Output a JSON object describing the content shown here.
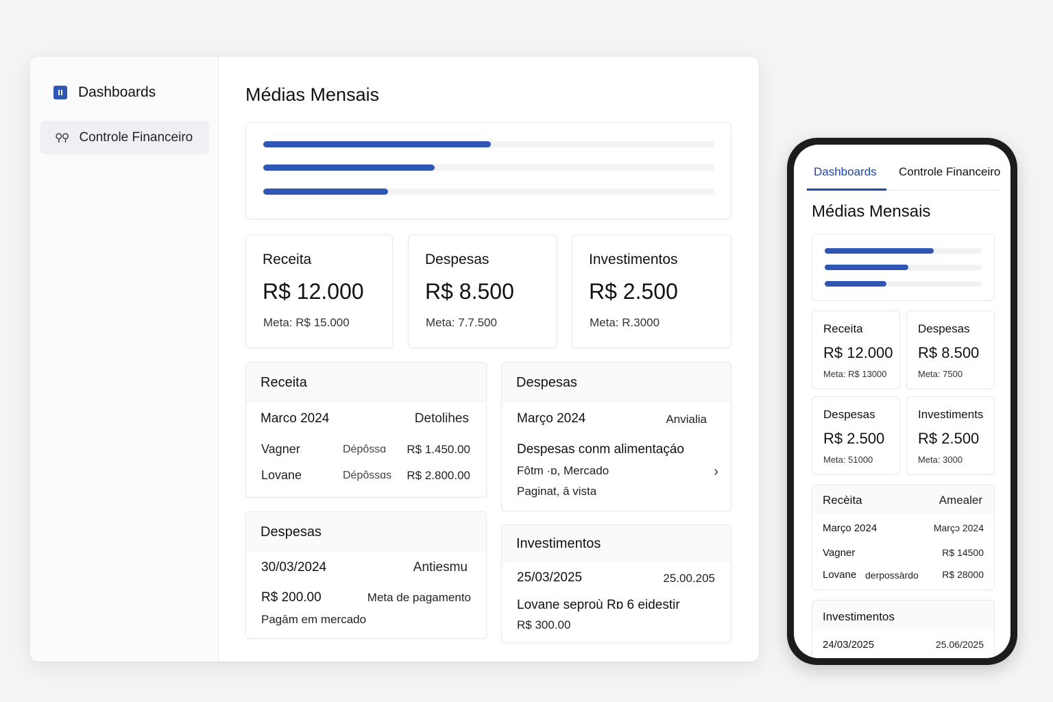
{
  "sidebar": {
    "title": "Dashboards",
    "items": [
      {
        "label": "Controle Financeiro"
      }
    ]
  },
  "main": {
    "title": "Médias Mensais",
    "progress": [
      0.505,
      0.38,
      0.277
    ],
    "stats": [
      {
        "label": "Receita",
        "value": "R$ 12.000",
        "meta": "Meta: R$ 15.000"
      },
      {
        "label": "Despesas",
        "value": "R$ 8.500",
        "meta": "Meta: 7.7.500"
      },
      {
        "label": "Investimentos",
        "value": "R$ 2.500",
        "meta": "Meta: R.3000"
      }
    ],
    "receita": {
      "title": "Receita",
      "period": "Marco 2024",
      "link": "Detolihes",
      "rows": [
        {
          "name": "Vagner",
          "type": "Dépôssɑ",
          "amount": "R$ 1.450.00"
        },
        {
          "name": "Lovane",
          "type": "Dépôssɑs",
          "amount": "R$ 2.800.00"
        }
      ]
    },
    "despesas_month": {
      "title": "Despesas",
      "period": "Março 2024",
      "link": "Anvialia",
      "item_title": "Despesas conm alimentaçáo",
      "line1": "Fôtm ·ɒ, Mercado",
      "line2": "Paginat, ā vista"
    },
    "despesas_date": {
      "title": "Despesas",
      "date": "30/03/2024",
      "link": "Antiesmu",
      "amount": "R$ 200.00",
      "status": "Meta de pagamento",
      "note": "Pagām em mercado"
    },
    "investimentos": {
      "title": "Investimentos",
      "date": "25/03/2025",
      "date2": "25.00.205",
      "desc": "Lovane seproù Rɒ 6  eidestir",
      "amount": "R$ 300.00"
    }
  },
  "mobile": {
    "tabs": [
      "Dashboards",
      "Controle Financeiro"
    ],
    "title": "Médias Mensais",
    "progress": [
      0.69,
      0.53,
      0.39
    ],
    "stats": [
      {
        "label": "Receita",
        "value": "R$ 12.000",
        "meta": "Meta: R$ 13000"
      },
      {
        "label": "Despesas",
        "value": "R$ 8.500",
        "meta": "Meta: 7500"
      },
      {
        "label": "Despesas",
        "value": "R$ 2.500",
        "meta": "Meta: 51000"
      },
      {
        "label": "Investiments",
        "value": "R$ 2.500",
        "meta": "Meta: 3000"
      }
    ],
    "receita": {
      "title": "Recèita",
      "link": "Amealer",
      "period": "Março 2024",
      "period2": "Marçɔ 2024",
      "rows": [
        {
          "name": "Vagner",
          "type": "",
          "amount": "R$ 14500"
        },
        {
          "name": "Lovane",
          "type": "derpossàrdo",
          "amount": "R$ 28000"
        }
      ]
    },
    "investimentos": {
      "title": "Investimentos",
      "date": "24/03/2025",
      "date2": "25.06/2025"
    }
  },
  "colors": {
    "accent": "#2f56b5",
    "tab_active": "#1f44a8"
  },
  "icons": [
    "dashboard-icon",
    "finance-icon",
    "chevron-right-icon"
  ]
}
